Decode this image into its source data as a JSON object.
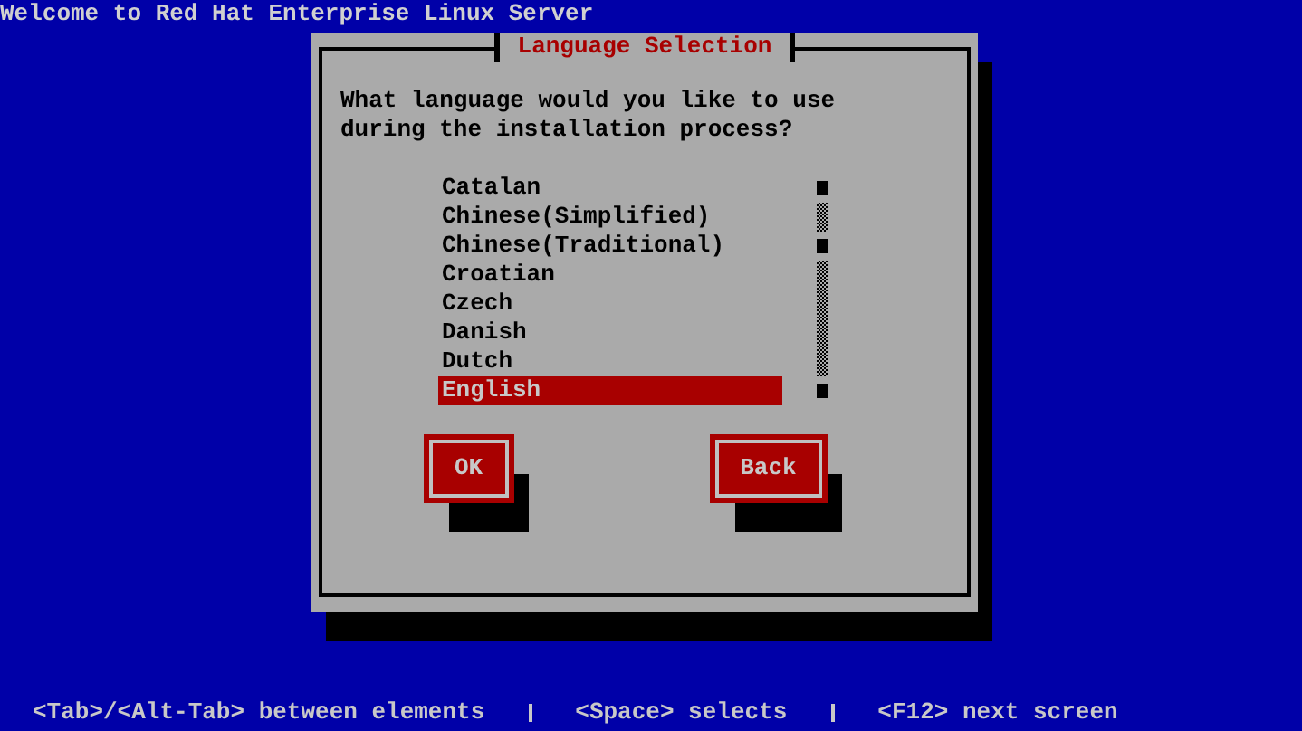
{
  "header": {
    "title": "Welcome to Red Hat Enterprise Linux Server"
  },
  "dialog": {
    "title": "Language Selection",
    "prompt": "What language would you like to use during the installation process?",
    "languages": [
      {
        "label": "Catalan",
        "selected": false
      },
      {
        "label": "Chinese(Simplified)",
        "selected": false
      },
      {
        "label": "Chinese(Traditional)",
        "selected": false
      },
      {
        "label": "Croatian",
        "selected": false
      },
      {
        "label": "Czech",
        "selected": false
      },
      {
        "label": "Danish",
        "selected": false
      },
      {
        "label": "Dutch",
        "selected": false
      },
      {
        "label": "English",
        "selected": true
      }
    ],
    "buttons": [
      {
        "label": "OK"
      },
      {
        "label": "Back"
      }
    ]
  },
  "status_bar": {
    "hints": [
      "<Tab>/<Alt-Tab> between elements",
      "<Space> selects",
      "<F12> next screen"
    ]
  }
}
